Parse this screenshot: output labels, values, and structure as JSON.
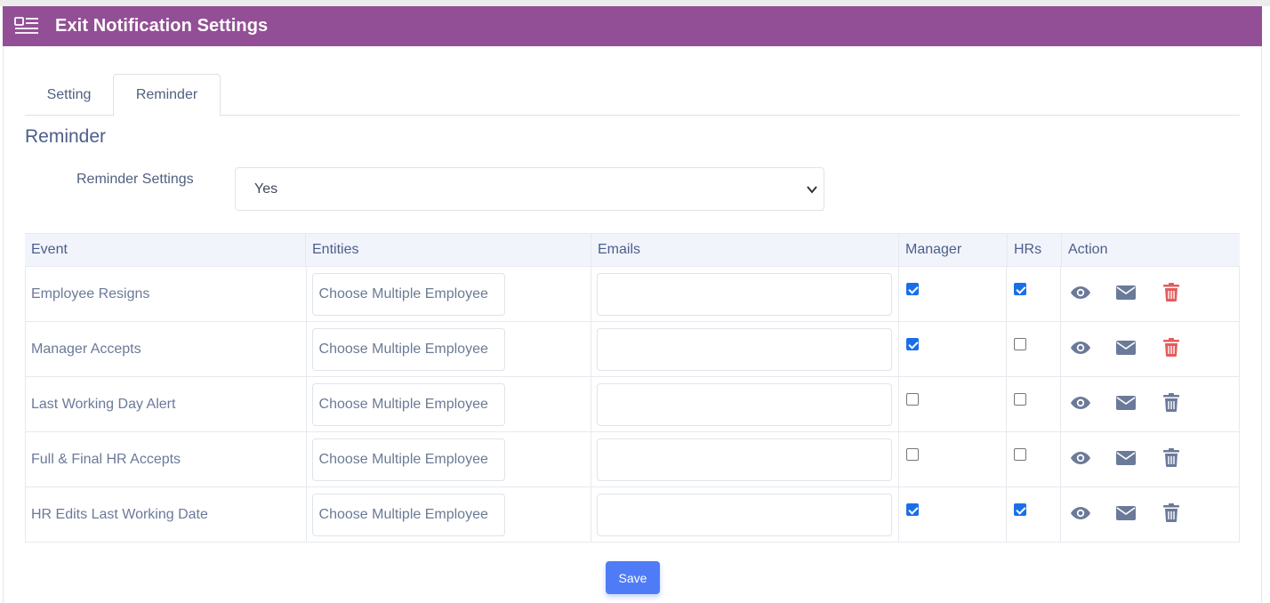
{
  "header": {
    "title": "Exit Notification Settings",
    "icon": "list-menu-icon"
  },
  "tabs": [
    {
      "label": "Setting",
      "active": false
    },
    {
      "label": "Reminder",
      "active": true
    }
  ],
  "section": {
    "title": "Reminder"
  },
  "reminder_settings": {
    "label": "Reminder Settings",
    "value": "Yes"
  },
  "table": {
    "headers": [
      "Event",
      "Entities",
      "Emails",
      "Manager",
      "HRs",
      "Action"
    ],
    "rows": [
      {
        "event": "Employee Resigns",
        "entities_placeholder": "Choose Multiple Employee",
        "email": "",
        "manager": true,
        "hrs": true,
        "delete_color": "#e35d5d"
      },
      {
        "event": "Manager Accepts",
        "entities_placeholder": "Choose Multiple Employee",
        "email": "",
        "manager": true,
        "hrs": false,
        "delete_color": "#e35d5d"
      },
      {
        "event": "Last Working Day Alert",
        "entities_placeholder": "Choose Multiple Employee",
        "email": "",
        "manager": false,
        "hrs": false,
        "delete_color": "#6b7a99"
      },
      {
        "event": "Full & Final HR Accepts",
        "entities_placeholder": "Choose Multiple Employee",
        "email": "",
        "manager": false,
        "hrs": false,
        "delete_color": "#6b7a99"
      },
      {
        "event": "HR Edits Last Working Date",
        "entities_placeholder": "Choose Multiple Employee",
        "email": "",
        "manager": true,
        "hrs": true,
        "delete_color": "#6b7a99"
      }
    ]
  },
  "actions": {
    "view_icon": "eye-icon",
    "mail_icon": "envelope-icon",
    "delete_icon": "trash-icon"
  },
  "save_label": "Save",
  "colors": {
    "header_bg": "#934f95",
    "accent": "#4f7cf6",
    "checkbox": "#1a6fe8",
    "danger": "#e35d5d"
  }
}
